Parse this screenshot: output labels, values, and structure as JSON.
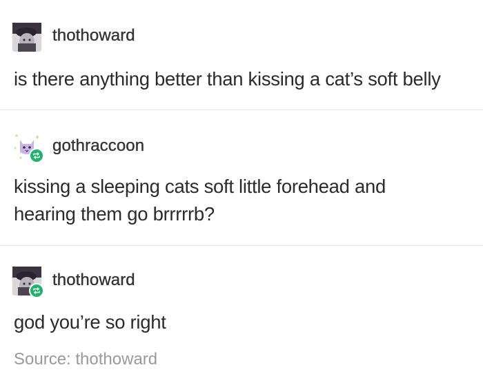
{
  "thread": {
    "posts": [
      {
        "username": "thothoward",
        "avatar_icon": "dark-avatar-icon",
        "reblogged": false,
        "lines": [
          "is there anything better than kissing a cat’s soft belly"
        ]
      },
      {
        "username": "gothraccoon",
        "avatar_icon": "lavender-cat-avatar-icon",
        "reblogged": true,
        "lines": [
          "kissing a sleeping cats soft little forehead and",
          "hearing them go brrrrrb?"
        ]
      },
      {
        "username": "thothoward",
        "avatar_icon": "dark-avatar-icon",
        "reblogged": true,
        "lines": [
          "god you’re so right"
        ]
      }
    ],
    "source_label": "Source: thothoward"
  },
  "colors": {
    "reblog_badge": "#1fb36b",
    "text": "#2b2b2b",
    "source_text": "#9a9a9a",
    "divider": "#e6e6e6"
  }
}
